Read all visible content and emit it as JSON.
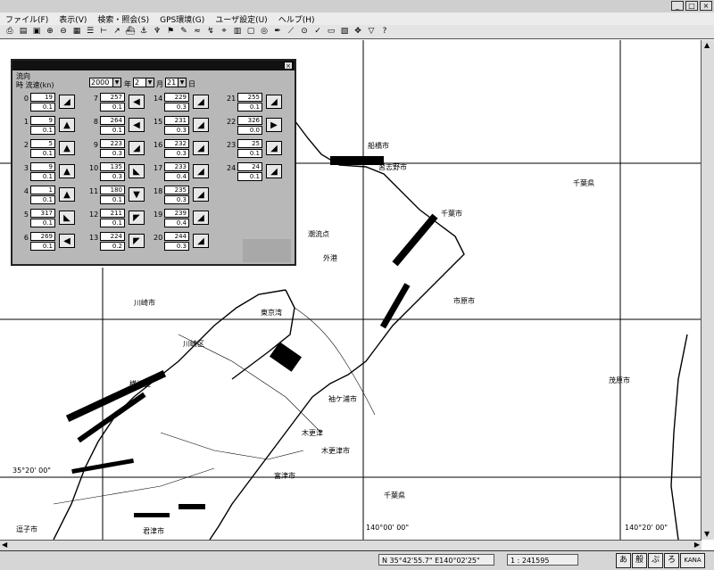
{
  "menu": [
    "ファイル(F)",
    "表示(V)",
    "検索・照会(S)",
    "GPS環境(G)",
    "ユーザ設定(U)",
    "ヘルプ(H)"
  ],
  "map": {
    "coords": {
      "lat_left": "35°20' 00\"",
      "lon_mid": "140°00' 00\"",
      "lon_right": "140°20' 00\""
    },
    "labels": [
      {
        "id": "funabashi",
        "text": "船橋市"
      },
      {
        "id": "narashino",
        "text": "習志野市"
      },
      {
        "id": "chiba1",
        "text": "千葉市"
      },
      {
        "id": "chibaken1",
        "text": "千葉県"
      },
      {
        "id": "kawasaki",
        "text": "川崎市"
      },
      {
        "id": "kawasakiku",
        "text": "川崎区"
      },
      {
        "id": "tokyowan",
        "text": "東京湾"
      },
      {
        "id": "ichihara",
        "text": "市原市"
      },
      {
        "id": "sodegaura",
        "text": "袖ケ浦市"
      },
      {
        "id": "kisarazu",
        "text": "木更津市"
      },
      {
        "id": "kisarazu2",
        "text": "木更津"
      },
      {
        "id": "futtsu",
        "text": "富津市"
      },
      {
        "id": "chibaken2",
        "text": "千葉県"
      },
      {
        "id": "yokosuka",
        "text": "横浜区"
      },
      {
        "id": "mobara",
        "text": "茂原市"
      },
      {
        "id": "gaikou",
        "text": "外港"
      },
      {
        "id": "choryu",
        "text": "潮流点"
      },
      {
        "id": "zushi",
        "text": "逗子市"
      },
      {
        "id": "kimitsu",
        "text": "君津市"
      }
    ]
  },
  "status": {
    "coord": "N 35°42'55.7\" E140°02'25\"",
    "scale": "1 : 241595"
  },
  "ime": [
    "あ",
    "般",
    "ぷ",
    "ろ",
    "KANA"
  ],
  "dialog": {
    "title": "流向",
    "header": "時  流速(kn)",
    "date_year": "2000",
    "date_month": "2",
    "date_day": "21",
    "lbl_year": "年",
    "lbl_month": "月",
    "lbl_day": "日",
    "rows": [
      {
        "hour": "0",
        "dir": "19",
        "speed": "0.1",
        "arrow": "◢"
      },
      {
        "hour": "1",
        "dir": "9",
        "speed": "0.1",
        "arrow": "▲"
      },
      {
        "hour": "2",
        "dir": "5",
        "speed": "0.1",
        "arrow": "▲"
      },
      {
        "hour": "3",
        "dir": "9",
        "speed": "0.1",
        "arrow": "▲"
      },
      {
        "hour": "4",
        "dir": "1",
        "speed": "0.1",
        "arrow": "▲"
      },
      {
        "hour": "5",
        "dir": "317",
        "speed": "0.1",
        "arrow": "◣"
      },
      {
        "hour": "6",
        "dir": "269",
        "speed": "0.1",
        "arrow": "◀"
      },
      {
        "hour": "7",
        "dir": "257",
        "speed": "0.1",
        "arrow": "◀"
      },
      {
        "hour": "8",
        "dir": "264",
        "speed": "0.1",
        "arrow": "◀"
      },
      {
        "hour": "9",
        "dir": "223",
        "speed": "0.3",
        "arrow": "◢"
      },
      {
        "hour": "10",
        "dir": "135",
        "speed": "0.3",
        "arrow": "◣"
      },
      {
        "hour": "11",
        "dir": "180",
        "speed": "0.1",
        "arrow": "▼"
      },
      {
        "hour": "12",
        "dir": "211",
        "speed": "0.1",
        "arrow": "◤"
      },
      {
        "hour": "13",
        "dir": "224",
        "speed": "0.2",
        "arrow": "◤"
      },
      {
        "hour": "14",
        "dir": "229",
        "speed": "0.3",
        "arrow": "◢"
      },
      {
        "hour": "15",
        "dir": "231",
        "speed": "0.3",
        "arrow": "◢"
      },
      {
        "hour": "16",
        "dir": "232",
        "speed": "0.3",
        "arrow": "◢"
      },
      {
        "hour": "17",
        "dir": "233",
        "speed": "0.4",
        "arrow": "◢"
      },
      {
        "hour": "18",
        "dir": "235",
        "speed": "0.3",
        "arrow": "◢"
      },
      {
        "hour": "19",
        "dir": "239",
        "speed": "0.4",
        "arrow": "◢"
      },
      {
        "hour": "20",
        "dir": "244",
        "speed": "0.3",
        "arrow": "◢"
      },
      {
        "hour": "21",
        "dir": "255",
        "speed": "0.1",
        "arrow": "◢"
      },
      {
        "hour": "22",
        "dir": "326",
        "speed": "0.0",
        "arrow": "▶"
      },
      {
        "hour": "23",
        "dir": "25",
        "speed": "0.1",
        "arrow": "◢"
      },
      {
        "hour": "24",
        "dir": "24",
        "speed": "0.1",
        "arrow": "◢"
      }
    ]
  }
}
